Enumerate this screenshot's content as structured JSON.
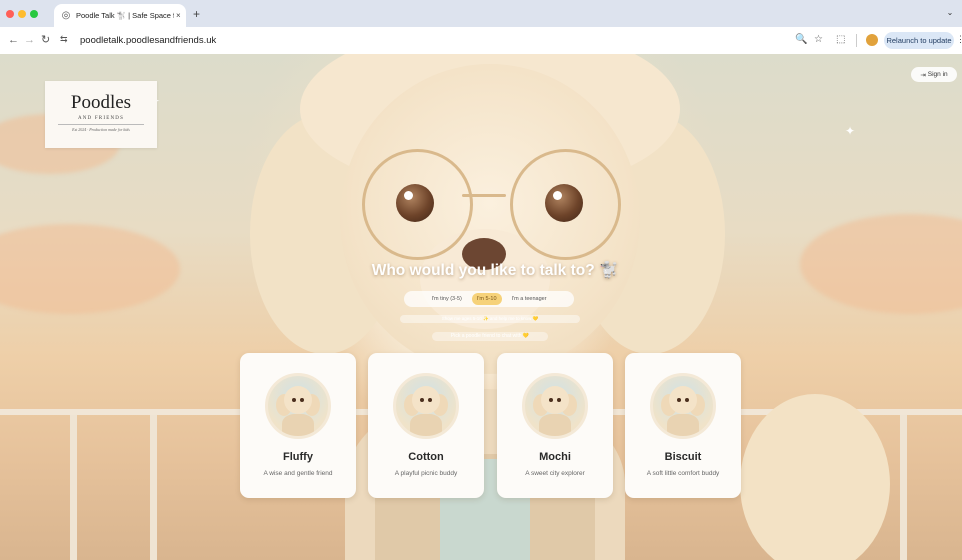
{
  "browser": {
    "tab_title": "Poodle Talk 🐩 | Safe Space f",
    "tab_close": "×",
    "new_tab": "+",
    "url": "poodletalk.poodlesandfriends.uk",
    "relaunch_label": "Relaunch to update",
    "icons": {
      "back": "←",
      "forward": "→",
      "reload": "↻",
      "site_info": "⇆",
      "zoom": "🔍",
      "star": "☆",
      "extensions": "⬚",
      "more": "⋮",
      "tabstrip_menu": "⌄"
    }
  },
  "page": {
    "logo": {
      "title": "Poodles",
      "subtitle": "AND FRIENDS",
      "tagline": "Est 2024 · Production made for kids"
    },
    "sign_in_label": "Sign in",
    "headline": "Who would you like to talk to? 🐩",
    "age_options": [
      {
        "label": "I'm tiny (3-5)",
        "active": false
      },
      {
        "label": "I'm 5-10",
        "active": true
      },
      {
        "label": "I'm a teenager",
        "active": false
      }
    ],
    "age_note": "Show me ages 5-10 ✨ and help me to know 💛",
    "pick_prompt": "Pick a poodle friend to chat with 💛",
    "friends": [
      {
        "name": "Fluffy",
        "description": "A wise and gentle friend"
      },
      {
        "name": "Cotton",
        "description": "A playful picnic buddy"
      },
      {
        "name": "Mochi",
        "description": "A sweet city explorer"
      },
      {
        "name": "Biscuit",
        "description": "A soft little comfort buddy"
      }
    ]
  },
  "colors": {
    "accent_pill": "#f6d27a",
    "card_bg": "#fdfbf8",
    "chrome_tab_strip": "#dde3ee"
  }
}
